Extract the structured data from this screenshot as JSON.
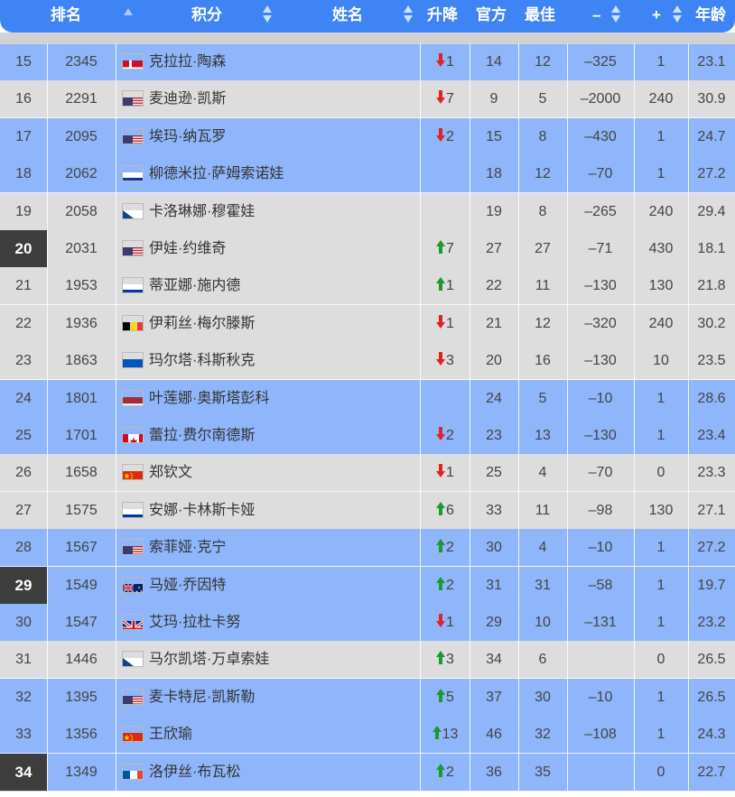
{
  "columns": {
    "rank": "排名",
    "score": "积分",
    "name": "姓名",
    "change": "升降",
    "official": "官方",
    "best": "最佳",
    "minus": "–",
    "plus": "+",
    "age": "年龄"
  },
  "colors": {
    "header": "#3e84f4",
    "row_blue": "#8fb6fb",
    "row_gray": "#dddddd",
    "rank_highlight": "#3d3d3d",
    "arrow_up": "#1a9b2c",
    "arrow_down": "#e02424"
  },
  "rows": [
    {
      "rank": "15",
      "score": "2345",
      "flag": "denmark-flag",
      "name": "克拉拉·陶森",
      "dir": "down",
      "chg": "1",
      "off": "14",
      "best": "12",
      "minus": "–325",
      "plus": "1",
      "age": "23.1",
      "bg": "blue",
      "hl": false
    },
    {
      "rank": "16",
      "score": "2291",
      "flag": "usa-flag",
      "name": "麦迪逊·凯斯",
      "dir": "down",
      "chg": "7",
      "off": "9",
      "best": "5",
      "minus": "–2000",
      "plus": "240",
      "age": "30.9",
      "bg": "gray",
      "hl": false
    },
    {
      "rank": "17",
      "score": "2095",
      "flag": "usa-flag",
      "name": "埃玛·纳瓦罗",
      "dir": "down",
      "chg": "2",
      "off": "15",
      "best": "8",
      "minus": "–430",
      "plus": "1",
      "age": "24.7",
      "bg": "blue",
      "hl": false
    },
    {
      "rank": "18",
      "score": "2062",
      "flag": "russia-flag",
      "name": "柳德米拉·萨姆索诺娃",
      "dir": "",
      "chg": "",
      "off": "18",
      "best": "12",
      "minus": "–70",
      "plus": "1",
      "age": "27.2",
      "bg": "blue",
      "hl": false
    },
    {
      "rank": "19",
      "score": "2058",
      "flag": "czech-flag",
      "name": "卡洛琳娜·穆霍娃",
      "dir": "",
      "chg": "",
      "off": "19",
      "best": "8",
      "minus": "–265",
      "plus": "240",
      "age": "29.4",
      "bg": "gray",
      "hl": false
    },
    {
      "rank": "20",
      "score": "2031",
      "flag": "usa-flag",
      "name": "伊娃·约维奇",
      "dir": "up",
      "chg": "7",
      "off": "27",
      "best": "27",
      "minus": "–71",
      "plus": "430",
      "age": "18.1",
      "bg": "gray",
      "hl": true
    },
    {
      "rank": "21",
      "score": "1953",
      "flag": "russia-flag",
      "name": "蒂亚娜·施内德",
      "dir": "up",
      "chg": "1",
      "off": "22",
      "best": "11",
      "minus": "–130",
      "plus": "130",
      "age": "21.8",
      "bg": "gray",
      "hl": false
    },
    {
      "rank": "22",
      "score": "1936",
      "flag": "belgium-flag",
      "name": "伊莉丝·梅尔滕斯",
      "dir": "down",
      "chg": "1",
      "off": "21",
      "best": "12",
      "minus": "–320",
      "plus": "240",
      "age": "30.2",
      "bg": "gray",
      "hl": false
    },
    {
      "rank": "23",
      "score": "1863",
      "flag": "ukraine-flag",
      "name": "玛尔塔·科斯秋克",
      "dir": "down",
      "chg": "3",
      "off": "20",
      "best": "16",
      "minus": "–130",
      "plus": "10",
      "age": "23.5",
      "bg": "gray",
      "hl": false
    },
    {
      "rank": "24",
      "score": "1801",
      "flag": "latvia-flag",
      "name": "叶莲娜·奥斯塔彭科",
      "dir": "",
      "chg": "",
      "off": "24",
      "best": "5",
      "minus": "–10",
      "plus": "1",
      "age": "28.6",
      "bg": "blue",
      "hl": false
    },
    {
      "rank": "25",
      "score": "1701",
      "flag": "canada-flag",
      "name": "蕾拉·费尔南德斯",
      "dir": "down",
      "chg": "2",
      "off": "23",
      "best": "13",
      "minus": "–130",
      "plus": "1",
      "age": "23.4",
      "bg": "blue",
      "hl": false
    },
    {
      "rank": "26",
      "score": "1658",
      "flag": "china-flag",
      "name": "郑钦文",
      "dir": "down",
      "chg": "1",
      "off": "25",
      "best": "4",
      "minus": "–70",
      "plus": "0",
      "age": "23.3",
      "bg": "gray",
      "hl": false
    },
    {
      "rank": "27",
      "score": "1575",
      "flag": "russia-flag",
      "name": "安娜·卡林斯卡娅",
      "dir": "up",
      "chg": "6",
      "off": "33",
      "best": "11",
      "minus": "–98",
      "plus": "130",
      "age": "27.1",
      "bg": "gray",
      "hl": false
    },
    {
      "rank": "28",
      "score": "1567",
      "flag": "usa-flag",
      "name": "索菲娅·克宁",
      "dir": "up",
      "chg": "2",
      "off": "30",
      "best": "4",
      "minus": "–10",
      "plus": "1",
      "age": "27.2",
      "bg": "blue",
      "hl": false
    },
    {
      "rank": "29",
      "score": "1549",
      "flag": "australia-flag",
      "name": "马娅·乔因特",
      "dir": "up",
      "chg": "2",
      "off": "31",
      "best": "31",
      "minus": "–58",
      "plus": "1",
      "age": "19.7",
      "bg": "blue",
      "hl": true
    },
    {
      "rank": "30",
      "score": "1547",
      "flag": "uk-flag",
      "name": "艾玛·拉杜卡努",
      "dir": "down",
      "chg": "1",
      "off": "29",
      "best": "10",
      "minus": "–131",
      "plus": "1",
      "age": "23.2",
      "bg": "blue",
      "hl": false
    },
    {
      "rank": "31",
      "score": "1446",
      "flag": "czech-flag",
      "name": "马尔凯塔·万卓索娃",
      "dir": "up",
      "chg": "3",
      "off": "34",
      "best": "6",
      "minus": "",
      "plus": "0",
      "age": "26.5",
      "bg": "gray",
      "hl": false
    },
    {
      "rank": "32",
      "score": "1395",
      "flag": "usa-flag",
      "name": "麦卡特尼·凯斯勒",
      "dir": "up",
      "chg": "5",
      "off": "37",
      "best": "30",
      "minus": "–10",
      "plus": "1",
      "age": "26.5",
      "bg": "blue",
      "hl": false
    },
    {
      "rank": "33",
      "score": "1356",
      "flag": "china-flag",
      "name": "王欣瑜",
      "dir": "up",
      "chg": "13",
      "off": "46",
      "best": "32",
      "minus": "–108",
      "plus": "1",
      "age": "24.3",
      "bg": "blue",
      "hl": false
    },
    {
      "rank": "34",
      "score": "1349",
      "flag": "france-flag",
      "name": "洛伊丝·布瓦松",
      "dir": "up",
      "chg": "2",
      "off": "36",
      "best": "35",
      "minus": "",
      "plus": "0",
      "age": "22.7",
      "bg": "blue",
      "hl": true
    }
  ]
}
